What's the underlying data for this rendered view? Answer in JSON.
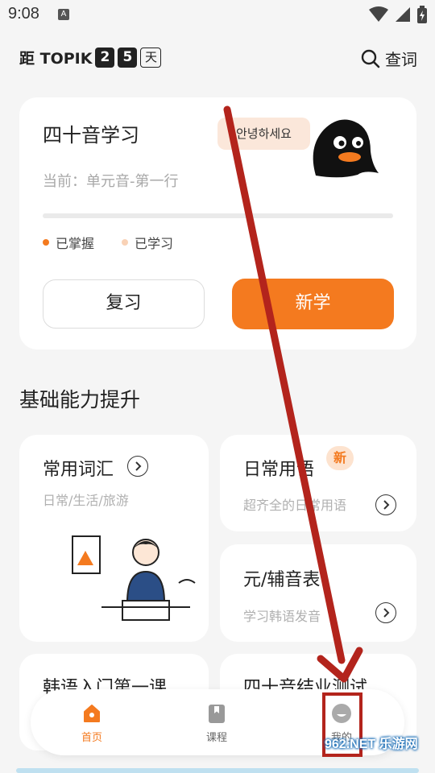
{
  "status_bar": {
    "time": "9:08",
    "notification_letter": "A"
  },
  "header": {
    "countdown_prefix": "距 TOPIK",
    "countdown_digits": [
      "2",
      "5"
    ],
    "countdown_unit": "天",
    "lookup_label": "查词"
  },
  "main_card": {
    "title": "四十音学习",
    "greeting_bubble": "안녕하세요",
    "current_lesson": "当前：单元音-第一行",
    "progress": 0.0,
    "legend": [
      {
        "label": "已掌握",
        "color": "#f47a1f"
      },
      {
        "label": "已学习",
        "color": "#f9d2b6"
      }
    ],
    "review_button": "复习",
    "new_button": "新学"
  },
  "section": {
    "title": "基础能力提升"
  },
  "feature_cards": {
    "vocab": {
      "title": "常用词汇",
      "subtitle": "日常/生活/旅游"
    },
    "phrases": {
      "title": "日常用语",
      "subtitle": "超齐全的日常用语",
      "badge": "新"
    },
    "vowels": {
      "title": "元/辅音表",
      "subtitle": "学习韩语发音"
    },
    "first_lesson": {
      "title": "韩语入门第一课"
    },
    "graduation": {
      "title": "四十音结业测试"
    }
  },
  "tabbar": {
    "items": [
      {
        "label": "首页",
        "icon": "home-icon",
        "active": true
      },
      {
        "label": "课程",
        "icon": "bookmark-icon",
        "active": false
      },
      {
        "label": "我的",
        "icon": "profile-icon",
        "active": false
      }
    ]
  },
  "watermark": "962.NET 乐游网",
  "colors": {
    "accent": "#f47a1f",
    "annotation_red": "#b3241c"
  }
}
